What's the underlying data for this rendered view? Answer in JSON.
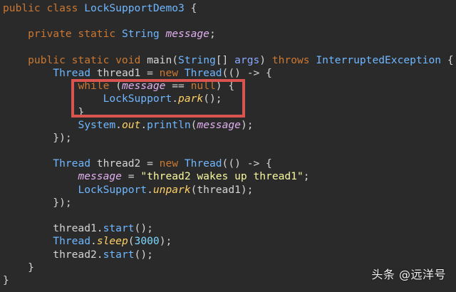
{
  "editor": {
    "lines": [
      [
        {
          "t": "public class ",
          "c": "kw"
        },
        {
          "t": "LockSupportDemo3",
          "c": "cls"
        },
        {
          "t": " {",
          "c": "plain"
        }
      ],
      [
        {
          "t": "",
          "c": "plain"
        }
      ],
      [
        {
          "t": "    private static ",
          "c": "kw"
        },
        {
          "t": "String",
          "c": "cls"
        },
        {
          "t": " ",
          "c": "plain"
        },
        {
          "t": "message",
          "c": "field"
        },
        {
          "t": ";",
          "c": "plain"
        }
      ],
      [
        {
          "t": "",
          "c": "plain"
        }
      ],
      [
        {
          "t": "    public static void ",
          "c": "kw"
        },
        {
          "t": "main",
          "c": "fn"
        },
        {
          "t": "(",
          "c": "plain"
        },
        {
          "t": "String",
          "c": "cls"
        },
        {
          "t": "[] ",
          "c": "plain"
        },
        {
          "t": "args",
          "c": "kw2"
        },
        {
          "t": ") ",
          "c": "plain"
        },
        {
          "t": "throws ",
          "c": "kw"
        },
        {
          "t": "InterruptedException",
          "c": "cls"
        },
        {
          "t": " {",
          "c": "plain"
        }
      ],
      [
        {
          "t": "        ",
          "c": "plain"
        },
        {
          "t": "Thread",
          "c": "cls"
        },
        {
          "t": " thread1 = ",
          "c": "plain"
        },
        {
          "t": "new ",
          "c": "kw"
        },
        {
          "t": "Thread",
          "c": "cls"
        },
        {
          "t": "(() -> {",
          "c": "plain"
        }
      ],
      [
        {
          "t": "            ",
          "c": "plain"
        },
        {
          "t": "while ",
          "c": "kw"
        },
        {
          "t": "(",
          "c": "plain"
        },
        {
          "t": "message",
          "c": "field"
        },
        {
          "t": " == ",
          "c": "plain"
        },
        {
          "t": "null",
          "c": "kw"
        },
        {
          "t": ") {",
          "c": "plain"
        }
      ],
      [
        {
          "t": "                ",
          "c": "plain"
        },
        {
          "t": "LockSupport",
          "c": "cls"
        },
        {
          "t": ".",
          "c": "plain"
        },
        {
          "t": "park",
          "c": "static"
        },
        {
          "t": "();",
          "c": "plain"
        }
      ],
      [
        {
          "t": "            }",
          "c": "plain"
        }
      ],
      [
        {
          "t": "            ",
          "c": "plain"
        },
        {
          "t": "System",
          "c": "cls"
        },
        {
          "t": ".",
          "c": "plain"
        },
        {
          "t": "out",
          "c": "static"
        },
        {
          "t": ".",
          "c": "plain"
        },
        {
          "t": "println",
          "c": "cls"
        },
        {
          "t": "(",
          "c": "plain"
        },
        {
          "t": "message",
          "c": "field"
        },
        {
          "t": ");",
          "c": "plain"
        }
      ],
      [
        {
          "t": "        });",
          "c": "plain"
        }
      ],
      [
        {
          "t": "",
          "c": "plain"
        }
      ],
      [
        {
          "t": "        ",
          "c": "plain"
        },
        {
          "t": "Thread",
          "c": "cls"
        },
        {
          "t": " thread2 = ",
          "c": "plain"
        },
        {
          "t": "new ",
          "c": "kw"
        },
        {
          "t": "Thread",
          "c": "cls"
        },
        {
          "t": "(() -> {",
          "c": "plain"
        }
      ],
      [
        {
          "t": "            ",
          "c": "plain"
        },
        {
          "t": "message",
          "c": "field"
        },
        {
          "t": " = ",
          "c": "plain"
        },
        {
          "t": "\"thread2 wakes up thread1\"",
          "c": "str"
        },
        {
          "t": ";",
          "c": "plain"
        }
      ],
      [
        {
          "t": "            ",
          "c": "plain"
        },
        {
          "t": "LockSupport",
          "c": "cls"
        },
        {
          "t": ".",
          "c": "plain"
        },
        {
          "t": "unpark",
          "c": "static"
        },
        {
          "t": "(thread1);",
          "c": "plain"
        }
      ],
      [
        {
          "t": "        });",
          "c": "plain"
        }
      ],
      [
        {
          "t": "",
          "c": "plain"
        }
      ],
      [
        {
          "t": "        thread1.",
          "c": "plain"
        },
        {
          "t": "start",
          "c": "cls"
        },
        {
          "t": "();",
          "c": "plain"
        }
      ],
      [
        {
          "t": "        ",
          "c": "plain"
        },
        {
          "t": "Thread",
          "c": "cls"
        },
        {
          "t": ".",
          "c": "plain"
        },
        {
          "t": "sleep",
          "c": "static"
        },
        {
          "t": "(",
          "c": "plain"
        },
        {
          "t": "3000",
          "c": "num"
        },
        {
          "t": ");",
          "c": "plain"
        }
      ],
      [
        {
          "t": "        thread2.",
          "c": "plain"
        },
        {
          "t": "start",
          "c": "cls"
        },
        {
          "t": "();",
          "c": "plain"
        }
      ],
      [
        {
          "t": "    }",
          "c": "plain"
        }
      ],
      [
        {
          "t": "}",
          "c": "plain"
        }
      ]
    ]
  },
  "watermark": {
    "text": "头条 @远洋号"
  },
  "colors": {
    "background": "#2a2a2a",
    "highlight_border": "#d9534f"
  }
}
